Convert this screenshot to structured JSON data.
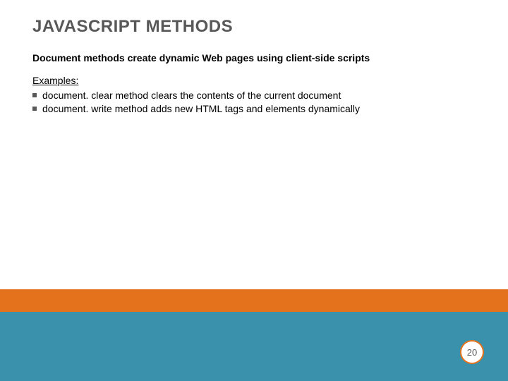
{
  "title": "JAVASCRIPT METHODS",
  "subtitle": "Document methods create dynamic Web pages using client-side scripts",
  "examples_label": "Examples:",
  "bullets": [
    "document. clear method clears the contents of the current document",
    "document. write method adds new HTML tags and elements dynamically"
  ],
  "page_number": "20",
  "colors": {
    "title": "#595858",
    "orange": "#e4721d",
    "teal": "#3a91ac"
  }
}
